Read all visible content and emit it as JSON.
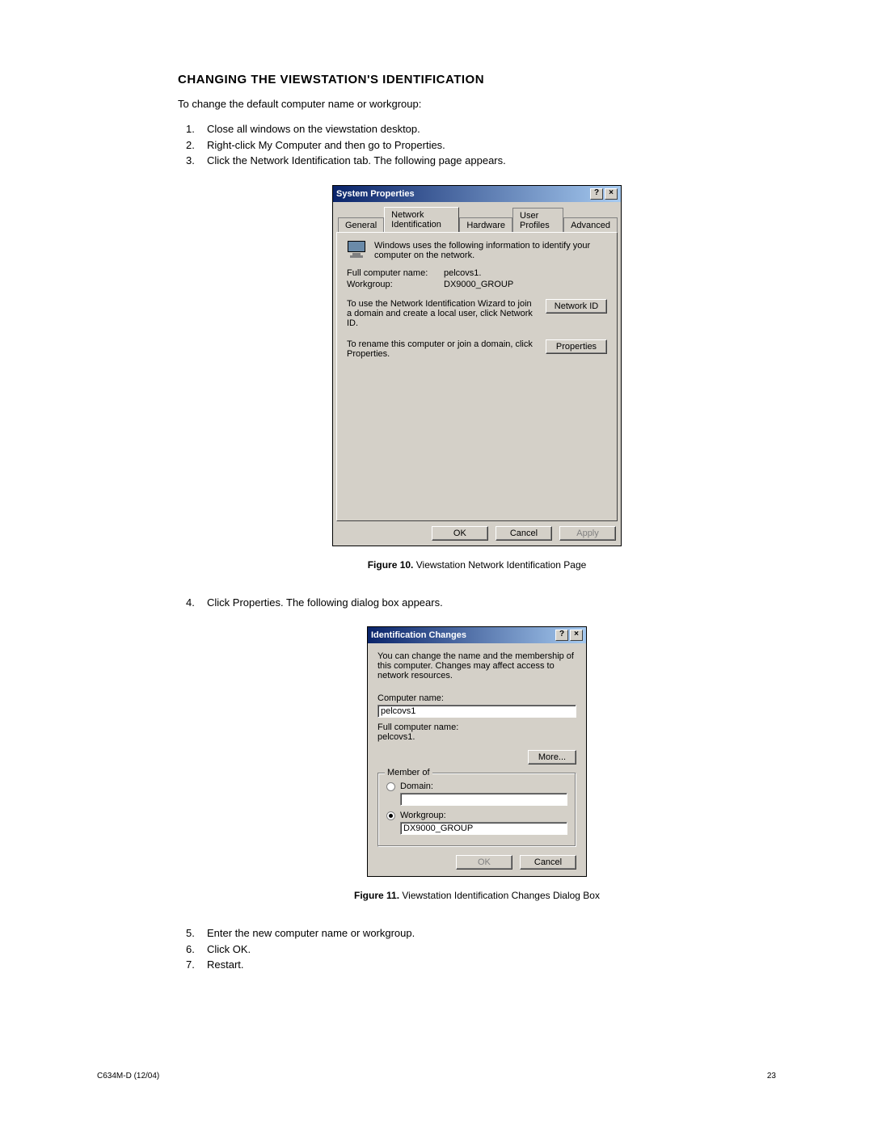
{
  "heading": "CHANGING THE VIEWSTATION'S IDENTIFICATION",
  "intro": "To change the default computer name or workgroup:",
  "steps1": {
    "n1": "1.",
    "t1": "Close all windows on the viewstation desktop.",
    "n2": "2.",
    "t2": "Right-click My Computer and then go to Properties.",
    "n3": "3.",
    "t3": "Click the Network Identification tab. The following page appears."
  },
  "fig10": {
    "label": "Figure 10.",
    "text": "Viewstation Network Identification Page"
  },
  "step4": {
    "n": "4.",
    "t": "Click Properties. The following dialog box appears."
  },
  "fig11": {
    "label": "Figure 11.",
    "text": "Viewstation Identification Changes Dialog Box"
  },
  "steps2": {
    "n5": "5.",
    "t5": "Enter the new computer name or workgroup.",
    "n6": "6.",
    "t6": "Click OK.",
    "n7": "7.",
    "t7": "Restart."
  },
  "footer": {
    "left": "C634M-D (12/04)",
    "right": "23"
  },
  "dlg1": {
    "title": "System Properties",
    "tabs": [
      "General",
      "Network Identification",
      "Hardware",
      "User Profiles",
      "Advanced"
    ],
    "info": "Windows uses the following information to identify your computer on the network.",
    "fcn_label": "Full computer name:",
    "fcn_value": "pelcovs1.",
    "wg_label": "Workgroup:",
    "wg_value": "DX9000_GROUP",
    "wiz_text": "To use the Network Identification Wizard to join a domain and create a local user, click Network ID.",
    "wiz_btn": "Network ID",
    "ren_text": "To rename this computer or join a domain, click Properties.",
    "ren_btn": "Properties",
    "ok": "OK",
    "cancel": "Cancel",
    "apply": "Apply"
  },
  "dlg2": {
    "title": "Identification Changes",
    "desc": "You can change the name and the membership of this computer. Changes may affect access to network resources.",
    "cn_label": "Computer name:",
    "cn_value": "pelcovs1",
    "fcn_label": "Full computer name:",
    "fcn_value": "pelcovs1.",
    "more": "More...",
    "group_legend": "Member of",
    "domain_label": "Domain:",
    "domain_value": "",
    "workgroup_label": "Workgroup:",
    "workgroup_value": "DX9000_GROUP",
    "ok": "OK",
    "cancel": "Cancel"
  }
}
